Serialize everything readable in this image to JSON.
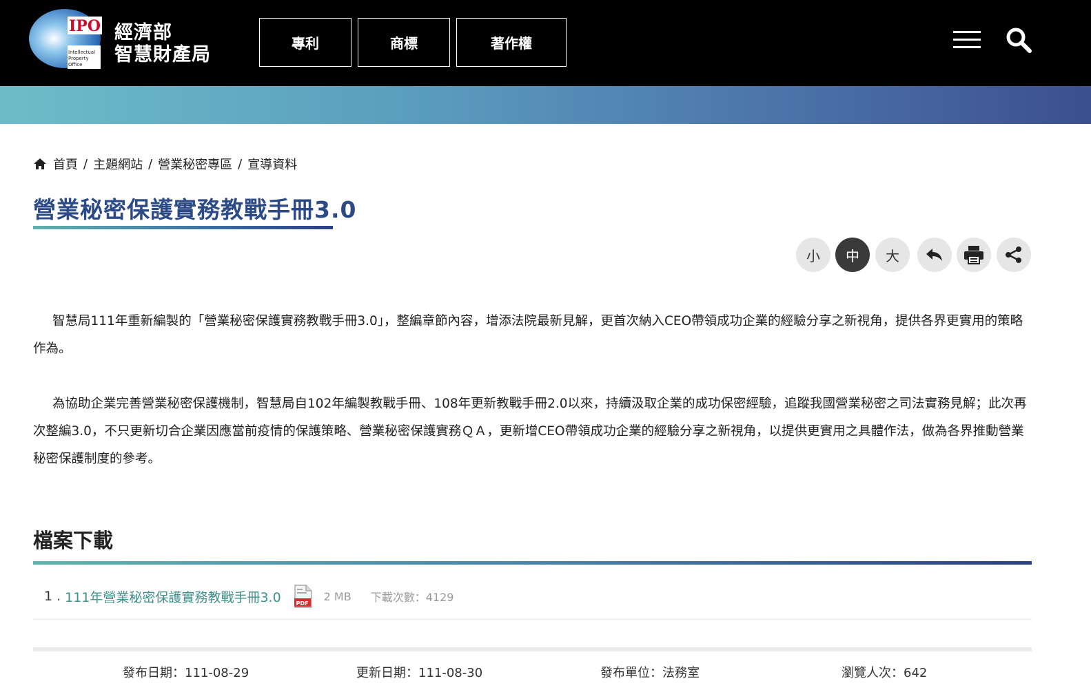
{
  "header": {
    "logo_text": "IPO",
    "logo_caption": "Intellectual Property Office",
    "org_line1": "經濟部",
    "org_line2": "智慧財產局",
    "nav": [
      "專利",
      "商標",
      "著作權"
    ]
  },
  "breadcrumb": [
    "首頁",
    "主題網站",
    "營業秘密專區",
    "宣導資料"
  ],
  "page_title": "營業秘密保護實務教戰手冊3.0",
  "tools": {
    "font_small": "小",
    "font_medium": "中",
    "font_large": "大",
    "icons": [
      "back-icon",
      "print-icon",
      "share-icon"
    ]
  },
  "content": {
    "para1": "智慧局111年重新編製的「營業秘密保護實務教戰手冊3.0」，整編章節內容，增添法院最新見解，更首次納入CEO帶領成功企業的經驗分享之新視角，提供各界更實用的策略作為。",
    "para2": "為協助企業完善營業秘密保護機制，智慧局自102年編製教戰手冊、108年更新教戰手冊2.0以來，持續汲取企業的成功保密經驗，追蹤我國營業秘密之司法實務見解；此次再次整編3.0，不只更新切合企業因應當前疫情的保護策略、營業秘密保護實務ＱＡ，更新增CEO帶領成功企業的經驗分享之新視角，以提供更實用之具體作法，做為各界推動營業秘密保護制度的參考。"
  },
  "downloads": {
    "title": "檔案下載",
    "items": [
      {
        "num": "1 .",
        "name": "111年營業秘密保護實務教戰手冊3.0",
        "size": "2 MB",
        "count": "下載次數：4129"
      }
    ]
  },
  "meta": {
    "publish": "發布日期：111-08-29",
    "update": "更新日期：111-08-30",
    "unit": "發布單位：法務室",
    "views": "瀏覽人次：642"
  },
  "colors": {
    "title": "#2c4a86",
    "link": "#3f8f8a",
    "header_bg": "#000000"
  }
}
